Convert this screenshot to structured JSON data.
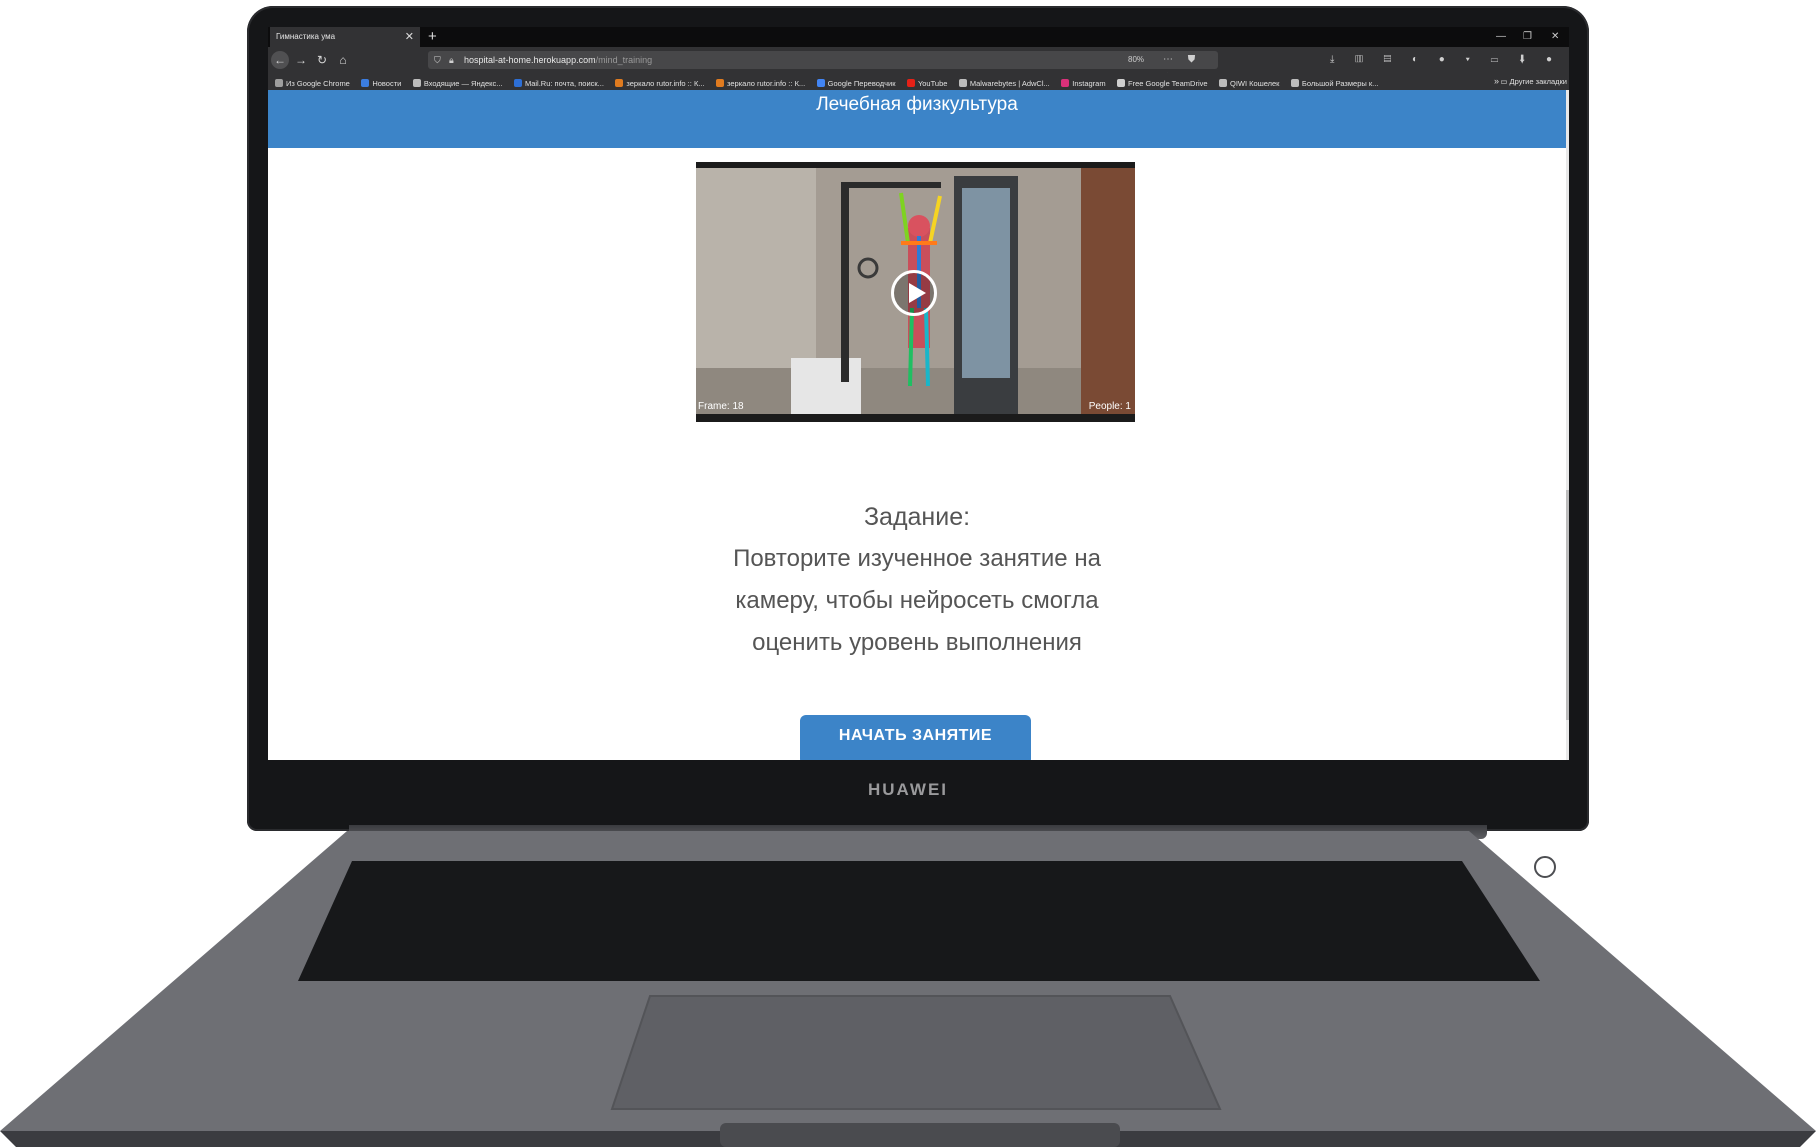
{
  "device": {
    "brand": "HUAWEI"
  },
  "browser": {
    "tab_title": "Гимнастика ума",
    "tab_close": "✕",
    "new_tab": "+",
    "url_host": "hospital-at-home.herokuapp.com",
    "url_path": "/mind_training",
    "zoom": "80%",
    "bookmarks": [
      {
        "label": "Из Google Chrome",
        "color": "#9e9e9e"
      },
      {
        "label": "Новости",
        "color": "#3b7de0"
      },
      {
        "label": "Входящие — Яндекс...",
        "color": "#bdbdbd"
      },
      {
        "label": "Mail.Ru: почта, поиск...",
        "color": "#2d6fd6"
      },
      {
        "label": "зеркало rutor.info :: К...",
        "color": "#e07b1f"
      },
      {
        "label": "зеркало rutor.info :: К...",
        "color": "#e07b1f"
      },
      {
        "label": "Google Переводчик",
        "color": "#4285f4"
      },
      {
        "label": "YouTube",
        "color": "#e62117"
      },
      {
        "label": "Malwarebytes | AdwCl...",
        "color": "#bdbdbd"
      },
      {
        "label": "Instagram",
        "color": "#d9317a"
      },
      {
        "label": "Free Google TeamDrive",
        "color": "#cfcfcf"
      },
      {
        "label": "QIWI Кошелек",
        "color": "#bdbdbd"
      },
      {
        "label": "Большой Размеры к...",
        "color": "#bdbdbd"
      }
    ],
    "bookmarks_more": "»",
    "other_bookmarks": "Другие закладки"
  },
  "page": {
    "header_title": "Лечебная физкультура",
    "video": {
      "frame_label": "Frame: 18",
      "people_label": "People: 1"
    },
    "task_title": "Задание:",
    "task_lines": [
      "Повторите изученное занятие на",
      "камеру, чтобы нейросеть смогла",
      "оценить уровень выполнения"
    ],
    "start_button": "НАЧАТЬ ЗАНЯТИЕ",
    "accent_color": "#3c84c8"
  }
}
